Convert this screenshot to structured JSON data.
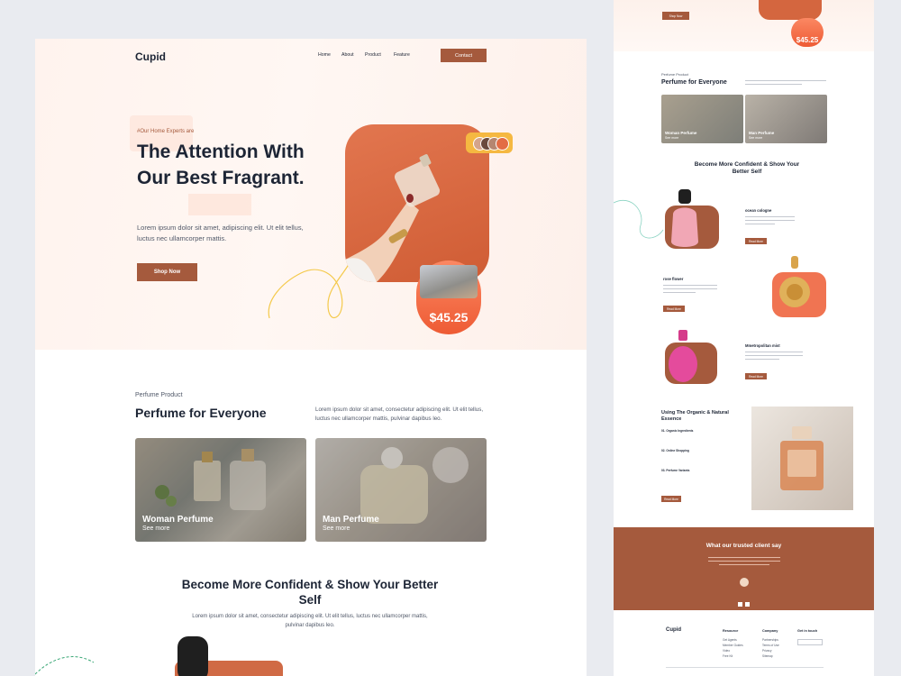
{
  "colors": {
    "accent": "#a55a3d",
    "orange": "#e36c44",
    "background": "#e9ebf0",
    "text": "#1d2535"
  },
  "main": {
    "logo": "Cupid",
    "nav": [
      "Home",
      "About",
      "Product",
      "Feature"
    ],
    "contact": "Contact",
    "hero": {
      "tag": "#Our Home Experts are",
      "title": "The Attention With Our Best Fragrant.",
      "subtitle": "Lorem ipsum dolor sit amet, adipiscing elit. Ut elit tellus, luctus nec ullamcorper mattis.",
      "cta": "Shop Now",
      "price": "$45.25"
    },
    "products": {
      "kicker": "Perfume Product",
      "title": "Perfume for Everyone",
      "description": "Lorem ipsum dolor sit amet, consectetur adipiscing elit. Ut elit tellus, luctus nec ullamcorper mattis, pulvinar dapibus leo.",
      "cards": [
        {
          "title": "Woman Perfume",
          "link": "See more"
        },
        {
          "title": "Man Perfume",
          "link": "See more"
        }
      ]
    },
    "confident": {
      "title": "Become More Confident & Show Your Better Self",
      "description": "Lorem ipsum dolor sit amet, consectetur adipiscing elit. Ut elit tellus, luctus nec ullamcorper mattis, pulvinar dapibus leo."
    }
  },
  "side": {
    "top_button": "Shop Now",
    "price": "$45.25",
    "products": {
      "kicker": "Perfume Product",
      "title": "Perfume for Everyone",
      "cards": [
        {
          "title": "Woman Perfume",
          "link": "See more"
        },
        {
          "title": "Man Perfume",
          "link": "See more"
        }
      ]
    },
    "confident_title": "Become More Confident & Show Your Better Self",
    "items": [
      {
        "name": "ocean cologne",
        "button": "Read More"
      },
      {
        "name": "rose flower",
        "button": "Read More"
      },
      {
        "name": "Mmetropolitan mist",
        "button": "Read More"
      }
    ],
    "organic": {
      "title": "Using The Organic & Natural Essence",
      "points": [
        "01. Organic Ingredients",
        "02. Online Shopping",
        "03. Perfume Variants"
      ],
      "button": "Read More"
    },
    "testimonial": {
      "title": "What our trusted client say"
    },
    "footer": {
      "logo": "Cupid",
      "columns": [
        {
          "heading": "Resource",
          "items": [
            "Get Agents",
            "Member Guides",
            "Video",
            "Free Kit"
          ]
        },
        {
          "heading": "Company",
          "items": [
            "Partnerships",
            "Terms of Use",
            "Privacy",
            "Sitemap"
          ]
        },
        {
          "heading": "Get in touch",
          "items": []
        }
      ]
    }
  }
}
